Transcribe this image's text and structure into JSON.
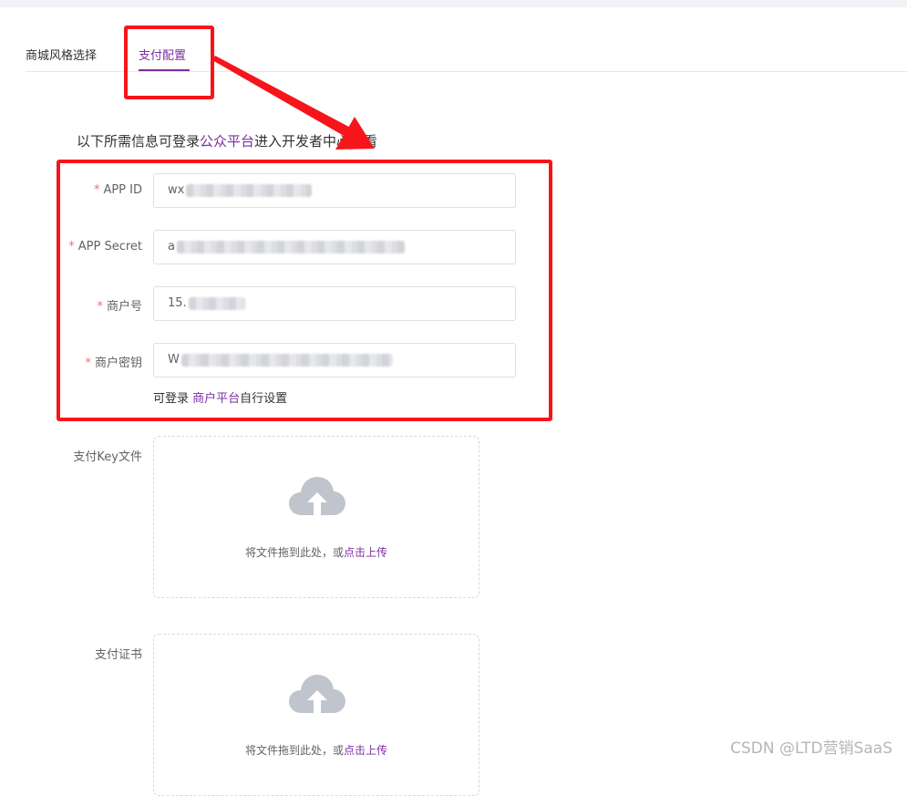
{
  "tabs": [
    {
      "label": "商城风格选择",
      "active": false
    },
    {
      "label": "支付配置",
      "active": true
    }
  ],
  "info": {
    "prefix": "以下所需信息可登录",
    "link": "公众平台",
    "suffix": "进入开发者中心查看"
  },
  "form": {
    "required_mark": "*",
    "app_id": {
      "label": "APP ID",
      "value": "wx"
    },
    "app_secret": {
      "label": "APP Secret",
      "value": "a"
    },
    "merchant_no": {
      "label": "商户号",
      "value": "15."
    },
    "merchant_key": {
      "label": "商户密钥",
      "value": "W"
    },
    "hint": {
      "prefix": "可登录 ",
      "link": "商户平台",
      "suffix": "自行设置"
    }
  },
  "uploads": [
    {
      "label": "支付Key文件",
      "text": "将文件拖到此处，或",
      "link": "点击上传",
      "icon": "upload-cloud-icon"
    },
    {
      "label": "支付证书",
      "text": "将文件拖到此处，或",
      "link": "点击上传",
      "icon": "upload-cloud-icon"
    }
  ],
  "watermark": "CSDN @LTD营销SaaS",
  "colors": {
    "accent": "#7b2fa2",
    "required": "#f56c6c",
    "highlight": "#f5151b"
  }
}
